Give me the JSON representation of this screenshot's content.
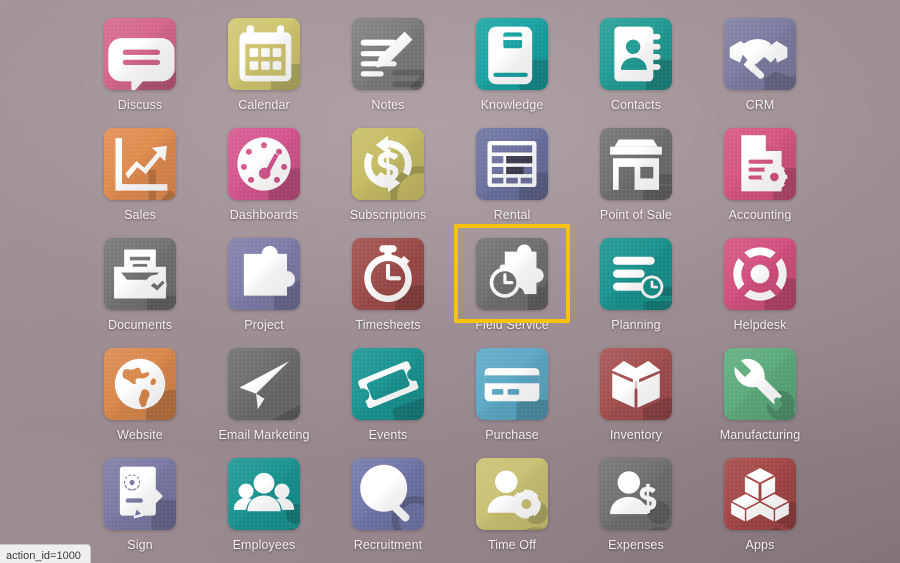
{
  "desktop": {
    "background_colors": [
      "#a89899",
      "#9b8b90",
      "#8d7e85"
    ],
    "selection_color": "#f9c211"
  },
  "status_tip": {
    "text": "action_id=1000"
  },
  "app_grid": {
    "columns": 6,
    "rows": 5,
    "selected_app": "Field Service",
    "apps": [
      {
        "label": "Discuss",
        "icon": "chat-bubble-icon",
        "color": "#d4648a"
      },
      {
        "label": "Calendar",
        "icon": "calendar-icon",
        "color": "#cfc56e"
      },
      {
        "label": "Notes",
        "icon": "note-pencil-icon",
        "color": "#7b7b7b"
      },
      {
        "label": "Knowledge",
        "icon": "book-icon",
        "color": "#17a2a2"
      },
      {
        "label": "Contacts",
        "icon": "address-book-icon",
        "color": "#1f9b93"
      },
      {
        "label": "CRM",
        "icon": "handshake-icon",
        "color": "#7b7ba0"
      },
      {
        "label": "Sales",
        "icon": "chart-up-icon",
        "color": "#e08a4c"
      },
      {
        "label": "Dashboards",
        "icon": "gauge-icon",
        "color": "#d4548c"
      },
      {
        "label": "Subscriptions",
        "icon": "dollar-refresh-icon",
        "color": "#c4bc62"
      },
      {
        "label": "Rental",
        "icon": "calendar-grid-icon",
        "color": "#6a6f9e"
      },
      {
        "label": "Point of Sale",
        "icon": "shop-icon",
        "color": "#6e6e6e"
      },
      {
        "label": "Accounting",
        "icon": "invoice-gear-icon",
        "color": "#d4527f"
      },
      {
        "label": "Documents",
        "icon": "file-box-check-icon",
        "color": "#717171"
      },
      {
        "label": "Project",
        "icon": "puzzle-icon",
        "color": "#7b7ba8"
      },
      {
        "label": "Timesheets",
        "icon": "stopwatch-icon",
        "color": "#9d4a48"
      },
      {
        "label": "Field Service",
        "icon": "puzzle-clock-icon",
        "color": "#6e6e6e"
      },
      {
        "label": "Planning",
        "icon": "planning-bars-icon",
        "color": "#17918c"
      },
      {
        "label": "Helpdesk",
        "icon": "lifebuoy-icon",
        "color": "#d24d7d"
      },
      {
        "label": "Website",
        "icon": "globe-icon",
        "color": "#d98649"
      },
      {
        "label": "Email Marketing",
        "icon": "paper-plane-icon",
        "color": "#6b6b6b"
      },
      {
        "label": "Events",
        "icon": "ticket-icon",
        "color": "#179390"
      },
      {
        "label": "Purchase",
        "icon": "credit-card-icon",
        "color": "#5aa7c4"
      },
      {
        "label": "Inventory",
        "icon": "open-box-icon",
        "color": "#a24d4d"
      },
      {
        "label": "Manufacturing",
        "icon": "wrench-icon",
        "color": "#5aaa7b"
      },
      {
        "label": "Sign",
        "icon": "sign-document-icon",
        "color": "#7878a4"
      },
      {
        "label": "Employees",
        "icon": "people-group-icon",
        "color": "#179390"
      },
      {
        "label": "Recruitment",
        "icon": "magnifier-person-icon",
        "color": "#6e74a6"
      },
      {
        "label": "Time Off",
        "icon": "person-gear-icon",
        "color": "#c8c070"
      },
      {
        "label": "Expenses",
        "icon": "person-dollar-icon",
        "color": "#6e6e6e"
      },
      {
        "label": "Apps",
        "icon": "cubes-icon",
        "color": "#a24444"
      }
    ]
  }
}
